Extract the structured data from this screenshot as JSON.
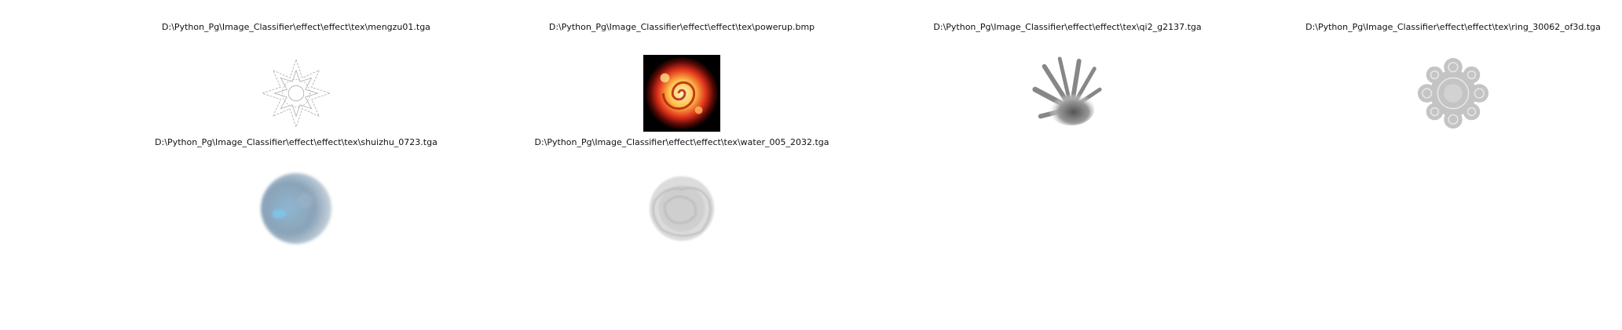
{
  "grid": {
    "cells": [
      {
        "title": "D:\\Python_Pg\\Image_Classifier\\effect\\effect\\tex\\mengzu01.tga",
        "icon": "lace-mandala-icon"
      },
      {
        "title": "D:\\Python_Pg\\Image_Classifier\\effect\\effect\\tex\\powerup.bmp",
        "icon": "fire-swirl-icon"
      },
      {
        "title": "D:\\Python_Pg\\Image_Classifier\\effect\\effect\\tex\\qi2_g2137.tga",
        "icon": "energy-burst-icon"
      },
      {
        "title": "D:\\Python_Pg\\Image_Classifier\\effect\\effect\\tex\\ring_30062_of3d.tga",
        "icon": "ornament-ring-icon"
      },
      {
        "title": "D:\\Python_Pg\\Image_Classifier\\effect\\effect\\tex\\shuizhu_0723.tga",
        "icon": "water-orb-icon"
      },
      {
        "title": "D:\\Python_Pg\\Image_Classifier\\effect\\effect\\tex\\water_005_2032.tga",
        "icon": "water-splash-icon"
      }
    ]
  }
}
